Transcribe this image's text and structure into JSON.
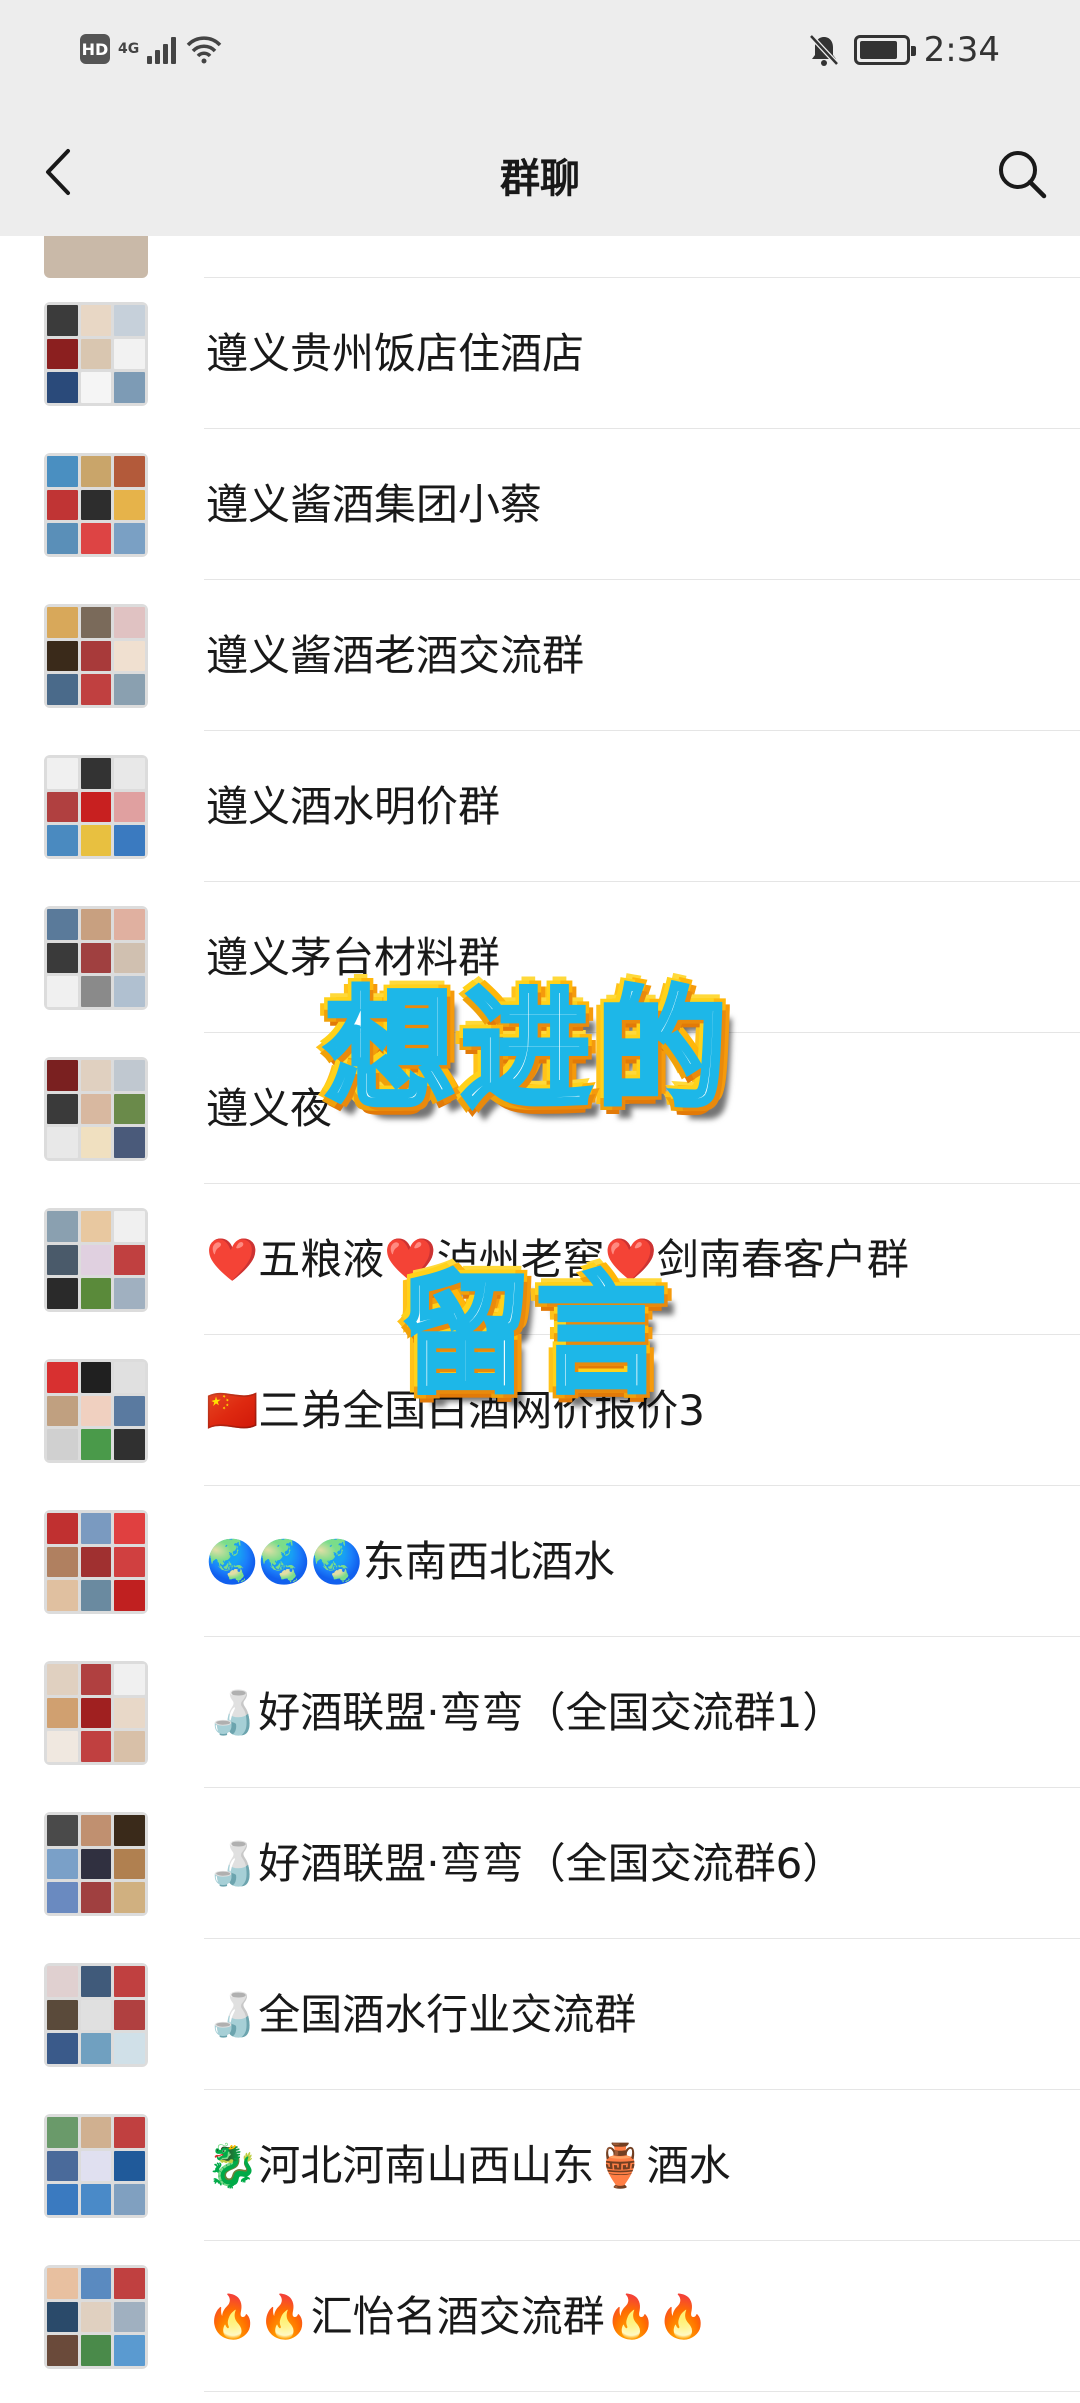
{
  "status_bar": {
    "hd_label": "HD",
    "network_label": "4G",
    "time": "2:34",
    "icons": [
      "hd-icon",
      "signal-icon",
      "wifi-icon",
      "mute-bell-icon",
      "battery-icon"
    ]
  },
  "header": {
    "title": "群聊",
    "back_icon": "chevron-left-icon",
    "search_icon": "search-icon"
  },
  "groups": [
    {
      "name": "遵义贵州饭店住酒店"
    },
    {
      "name": "遵义酱酒集团小蔡"
    },
    {
      "name": "遵义酱酒老酒交流群"
    },
    {
      "name": "遵义酒水明价群"
    },
    {
      "name": "遵义茅台材料群"
    },
    {
      "name": "遵义夜"
    },
    {
      "name": "❤️五粮液❤️泸州老窖❤️剑南春客户群"
    },
    {
      "name": "🇨🇳三弟全国白酒网价报价3"
    },
    {
      "name": "🌏🌏🌏东南西北酒水"
    },
    {
      "name": "🍶好酒联盟·弯弯（全国交流群1）"
    },
    {
      "name": "🍶好酒联盟·弯弯（全国交流群6）"
    },
    {
      "name": "🍶全国酒水行业交流群"
    },
    {
      "name": "🐉河北河南山西山东🏺酒水"
    },
    {
      "name": "🔥🔥汇怡名酒交流群🔥🔥"
    }
  ],
  "overlay": {
    "line1": "想进的",
    "line2": "留言"
  },
  "colors": {
    "bar_bg": "#ededed",
    "list_bg": "#ffffff",
    "divider": "#e5e5e5",
    "text": "#191919"
  }
}
